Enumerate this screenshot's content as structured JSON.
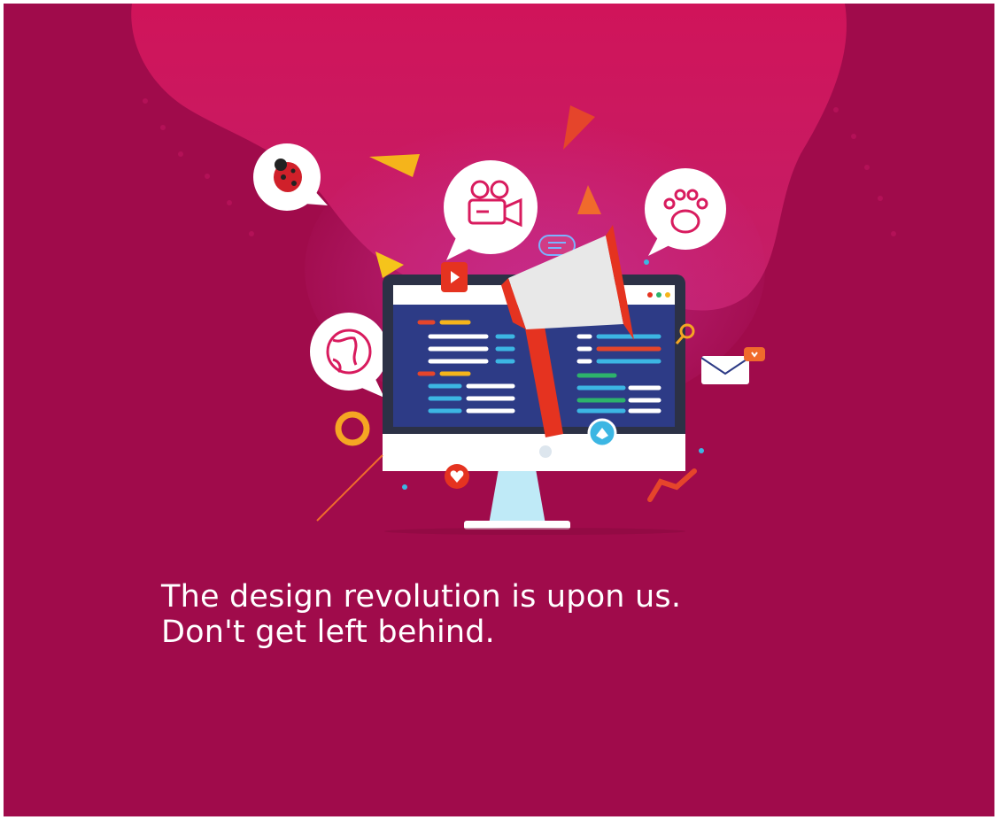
{
  "colors": {
    "background": "#a00b4b",
    "blob": "#d81b5e",
    "monitor_screen": "#2d3b86",
    "megaphone": "#e53320",
    "text": "#ffffff"
  },
  "headline": {
    "line1": "The design revolution is upon us.",
    "line2": "Don't get left behind."
  },
  "icons": [
    "ladybug-icon",
    "video-camera-icon",
    "paw-icon",
    "globe-icon",
    "megaphone-icon",
    "monitor-icon",
    "envelope-icon",
    "play-icon",
    "heart-icon",
    "like-icon",
    "paper-plane-icon",
    "ring-icon"
  ]
}
